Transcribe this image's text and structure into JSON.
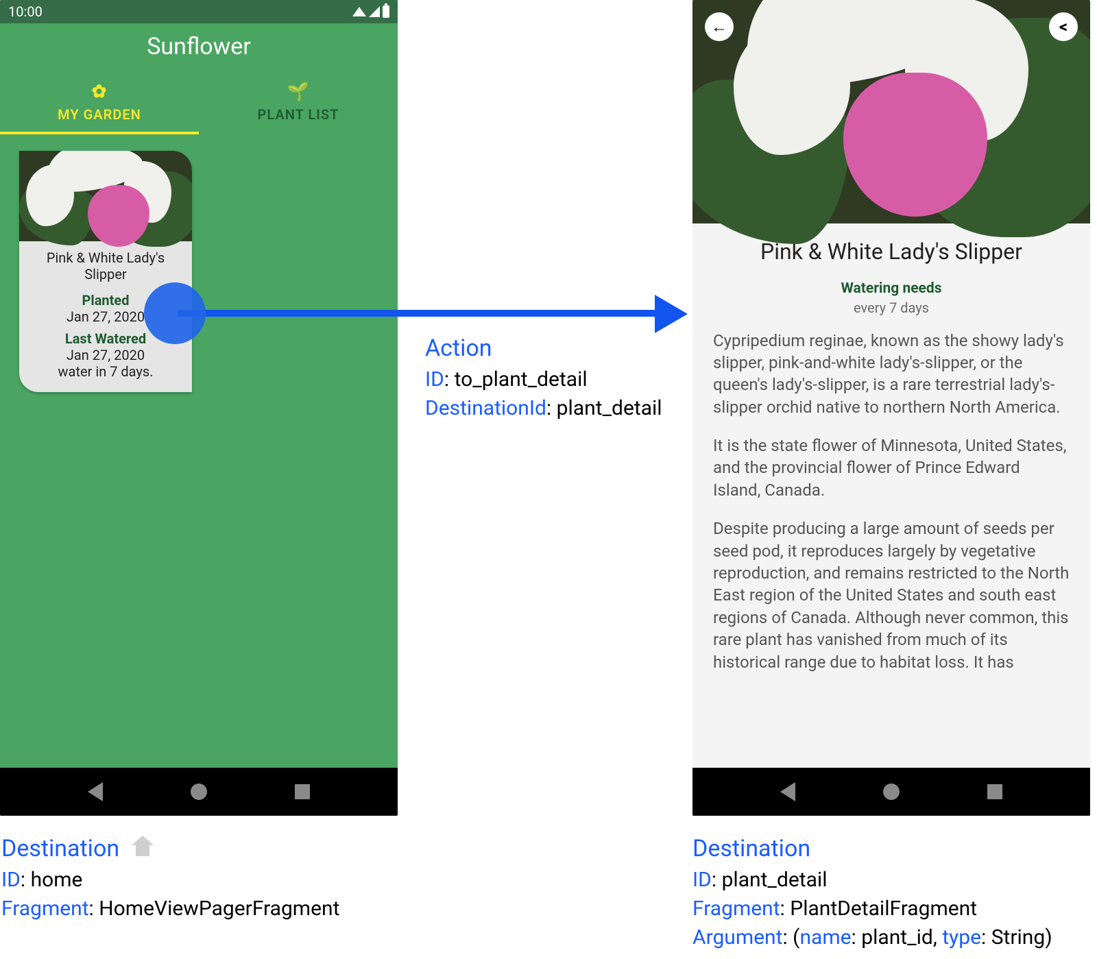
{
  "status_time": "10:00",
  "left": {
    "app_title": "Sunflower",
    "tabs": [
      {
        "label": "MY GARDEN",
        "icon": "flower-icon",
        "active": true
      },
      {
        "label": "PLANT LIST",
        "icon": "sprout-icon",
        "active": false
      }
    ],
    "card": {
      "plant_name": "Pink & White Lady's Slipper",
      "planted_label": "Planted",
      "planted_date": "Jan 27, 2020",
      "watered_label": "Last Watered",
      "watered_date": "Jan 27, 2020",
      "water_due": "water in 7 days."
    },
    "destination": {
      "title": "Destination",
      "id_label": "ID",
      "id_value": "home",
      "fragment_label": "Fragment",
      "fragment_value": "HomeViewPagerFragment"
    }
  },
  "right": {
    "detail": {
      "title": "Pink & White Lady's Slipper",
      "watering_label": "Watering needs",
      "watering_value": "every 7 days",
      "p1": "Cypripedium reginae, known as the showy lady's slipper, pink-and-white lady's-slipper, or the queen's lady's-slipper, is a rare terrestrial lady's-slipper orchid native to northern North America.",
      "p2": "It is the state flower of Minnesota, United States, and the provincial flower of Prince Edward Island, Canada.",
      "p3": "Despite producing a large amount of seeds per seed pod, it reproduces largely by vegetative reproduction, and remains restricted to the North East region of the United States and south east regions of Canada. Although never common, this rare plant has vanished from much of its historical range due to habitat loss. It has"
    },
    "destination": {
      "title": "Destination",
      "id_label": "ID",
      "id_value": "plant_detail",
      "fragment_label": "Fragment",
      "fragment_value": "PlantDetailFragment",
      "arg_label": "Argument",
      "arg_name_label": "name",
      "arg_name_value": "plant_id",
      "arg_type_label": "type",
      "arg_type_value": "String"
    }
  },
  "action": {
    "title": "Action",
    "id_label": "ID",
    "id_value": "to_plant_detail",
    "dest_label": "DestinationId",
    "dest_value": "plant_detail"
  }
}
